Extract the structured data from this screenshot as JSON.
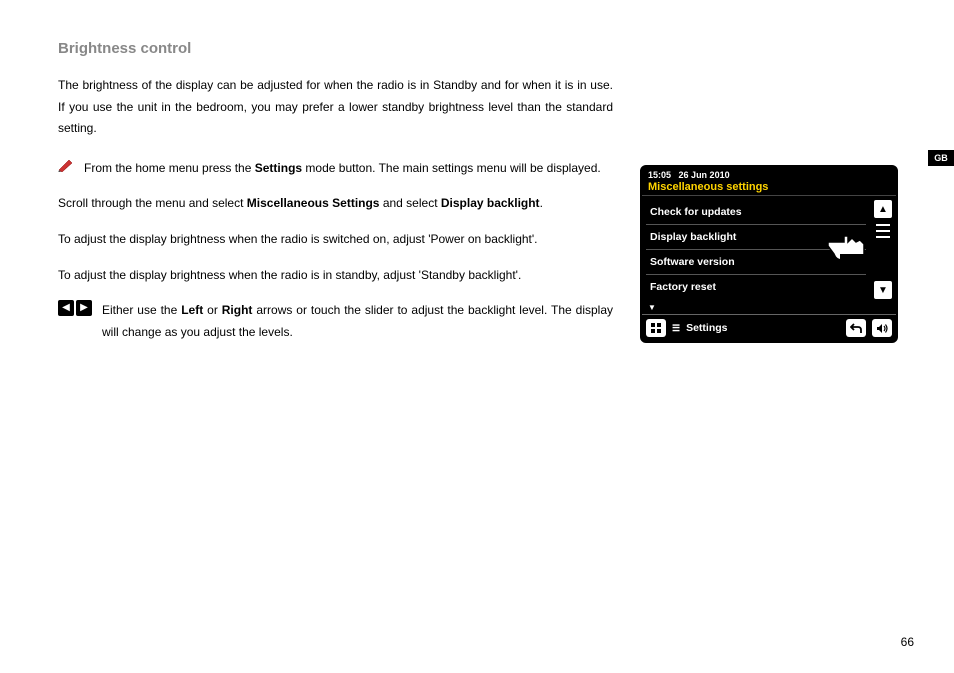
{
  "title": "Brightness control",
  "intro": "The brightness of the display can be adjusted for when the radio is in Standby and for when it is in use. If you use the unit in the bedroom, you may prefer a lower standby brightness level than the standard setting.",
  "step1_a": "From the home menu press the ",
  "step1_b": "Settings",
  "step1_c": " mode button. The main settings menu will be displayed.",
  "para2_a": "Scroll through the menu and select ",
  "para2_b": "Miscellaneous Settings",
  "para2_c": " and select ",
  "para2_d": "Display backlight",
  "para2_e": ".",
  "para3": "To adjust the display brightness when the radio is switched on, adjust 'Power on backlight'.",
  "para4": "To adjust the display brightness when the radio is in standby, adjust 'Standby backlight'.",
  "step5_a": "Either use the ",
  "step5_b": "Left",
  "step5_c": " or ",
  "step5_d": "Right",
  "step5_e": " arrows or touch the slider to adjust the backlight level. The display will change as you adjust the levels.",
  "device": {
    "time": "15:05",
    "date": "26 Jun 2010",
    "header": "Miscellaneous settings",
    "items": [
      "Check for updates",
      "Display backlight",
      "Software version",
      "Factory reset"
    ],
    "footer_label": "Settings"
  },
  "page_number": "66",
  "region": "GB"
}
